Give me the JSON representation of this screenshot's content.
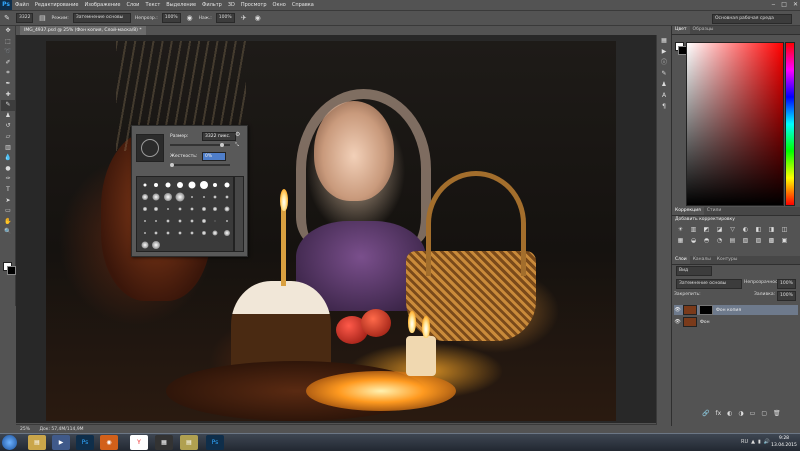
{
  "app": {
    "logo": "Ps"
  },
  "menu": [
    "Файл",
    "Редактирование",
    "Изображение",
    "Слои",
    "Текст",
    "Выделение",
    "Фильтр",
    "3D",
    "Просмотр",
    "Окно",
    "Справка"
  ],
  "window_controls": [
    "‒",
    "□",
    "✕"
  ],
  "options_bar": {
    "brush_size": "3322",
    "mode_label": "Режим:",
    "mode_value": "Затемнение основы",
    "opacity_label": "Непрозр.:",
    "opacity_value": "100%",
    "flow_label": "Наж.:",
    "flow_value": "100%",
    "workspace": "Основная рабочая среда"
  },
  "document_tab": "IMG_4937.psd @ 25% (Фон копия, Слой-маска/8) *",
  "tools": [
    "move-icon",
    "marquee-icon",
    "lasso-icon",
    "quick-select-icon",
    "crop-icon",
    "eyedropper-icon",
    "healing-icon",
    "brush-icon",
    "stamp-icon",
    "history-brush-icon",
    "eraser-icon",
    "gradient-icon",
    "blur-icon",
    "dodge-icon",
    "pen-icon",
    "type-icon",
    "path-select-icon",
    "shape-icon",
    "hand-icon",
    "zoom-icon"
  ],
  "brush_popup": {
    "size_label": "Размер:",
    "size_value": "3322 пикс.",
    "hardness_label": "Жесткость:",
    "hardness_value": "0%",
    "gear": "⚙"
  },
  "right_panels": {
    "color_tabs": [
      "Цвет",
      "Образцы"
    ],
    "adjust_tabs": [
      "Коррекция",
      "Стили"
    ],
    "adjust_title": "Добавить корректировку",
    "layers_tabs": [
      "Слои",
      "Каналы",
      "Контуры"
    ],
    "kind_label": "Вид",
    "blend_mode": "Затемнение основы",
    "opacity_label": "Непрозрачность:",
    "opacity_value": "100%",
    "lock_label": "Закрепить:",
    "fill_label": "Заливка:",
    "fill_value": "100%",
    "layers": [
      {
        "name": "Фон копия",
        "selected": true,
        "has_mask": true
      },
      {
        "name": "Фон",
        "selected": false,
        "has_mask": false
      }
    ]
  },
  "status_bar": {
    "zoom": "25%",
    "doc_size": "Док: 57,4M/114,9M"
  },
  "taskbar": {
    "tasks": [
      "folder-icon",
      "media-player-icon",
      "photoshop-icon",
      "firefox-icon",
      "yandex-icon",
      "media-icon",
      "explorer-icon",
      "photoshop-icon-2"
    ],
    "lang": "RU",
    "time": "9:28",
    "date": "13.04.2015"
  }
}
